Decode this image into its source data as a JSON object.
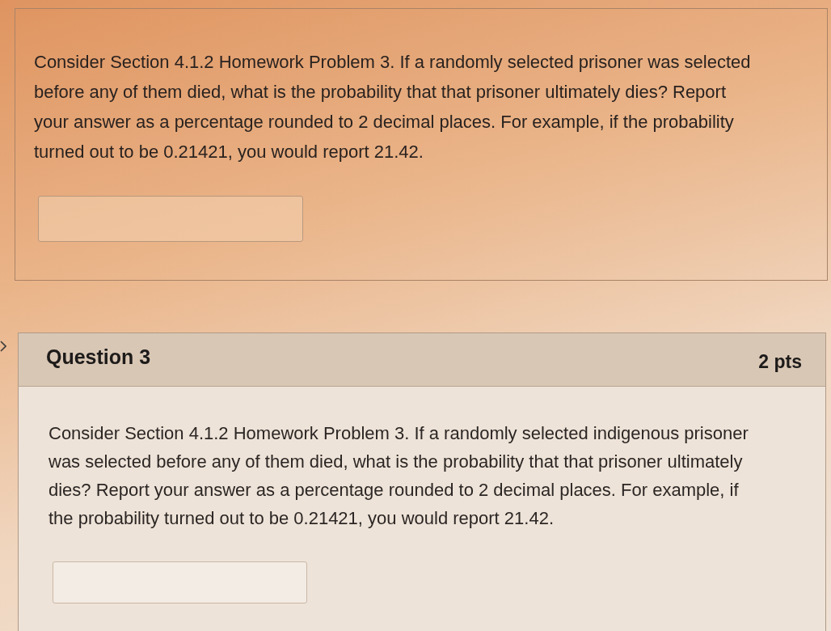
{
  "questions": [
    {
      "prompt": "Consider Section 4.1.2 Homework Problem 3. If a randomly selected prisoner was selected before any of them died, what is the probability that that prisoner ultimately dies? Report your answer as a percentage rounded to 2 decimal places. For example, if the probability turned out to be 0.21421, you would report 21.42."
    },
    {
      "title": "Question 3",
      "points": "2 pts",
      "prompt": "Consider Section 4.1.2 Homework Problem 3. If a randomly selected indigenous prisoner was selected before any of them died, what is the probability that that prisoner ultimately dies? Report your answer as a percentage rounded to 2 decimal places. For example, if the probability turned out to be 0.21421, you would report 21.42."
    }
  ]
}
